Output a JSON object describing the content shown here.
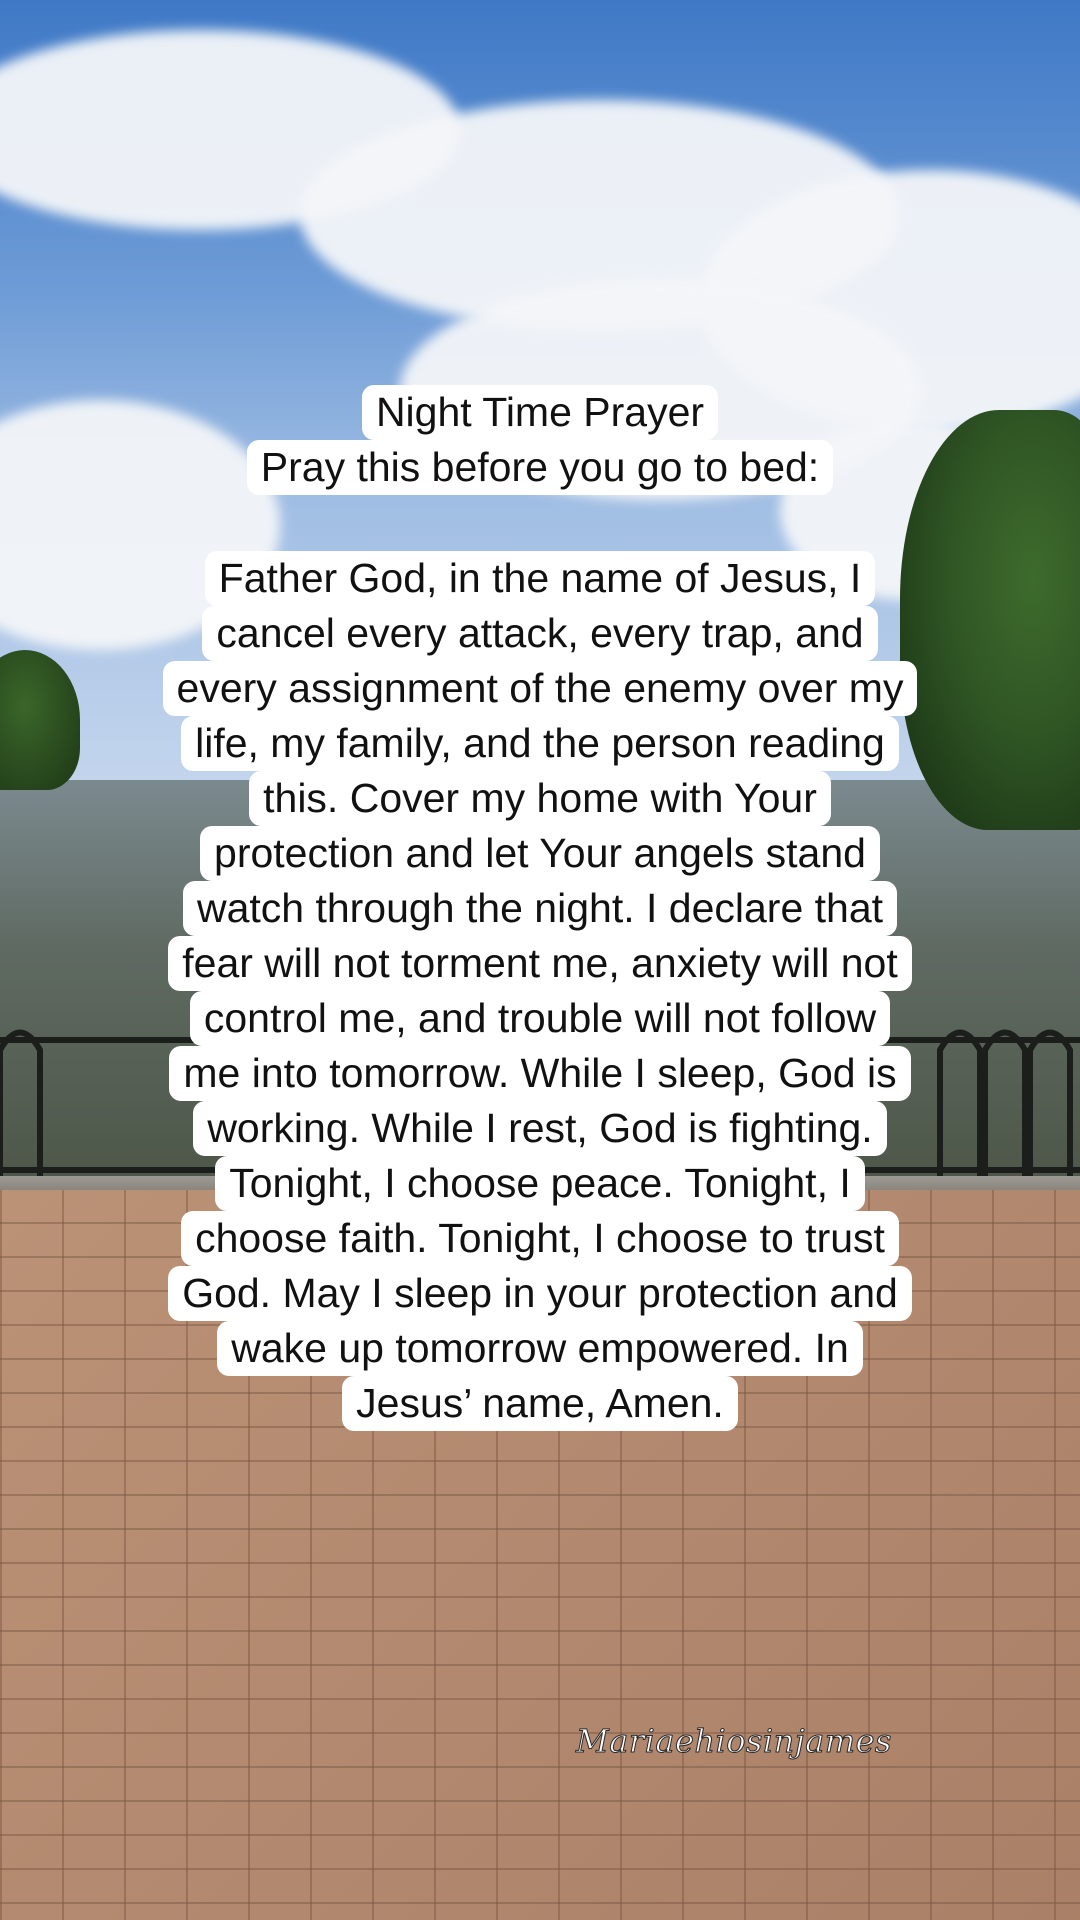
{
  "caption": {
    "title": "Night Time Prayer",
    "subtitle": "Pray this before you go to bed:",
    "body_lines": [
      "Father God, in the name of Jesus, I",
      "cancel every attack, every trap, and",
      "every assignment of the enemy over my",
      "life, my family, and the person reading",
      "this. Cover my home with Your",
      "protection and let Your angels stand",
      "watch through the night. I declare that",
      "fear will not torment me, anxiety will not",
      "control me, and trouble will not follow",
      "me into tomorrow. While I sleep, God is",
      "working. While I rest, God is fighting.",
      "Tonight, I choose peace. Tonight, I",
      "choose faith. Tonight, I choose to trust",
      "God. May I sleep in your protection and",
      "wake up tomorrow empowered. In",
      "Jesus’ name, Amen."
    ]
  },
  "watermark": "Mariaehiosinjames",
  "colors": {
    "caption_background": "#ffffff",
    "caption_text": "#111111",
    "sky": "#3f79c6",
    "paving": "#b48a6f"
  }
}
